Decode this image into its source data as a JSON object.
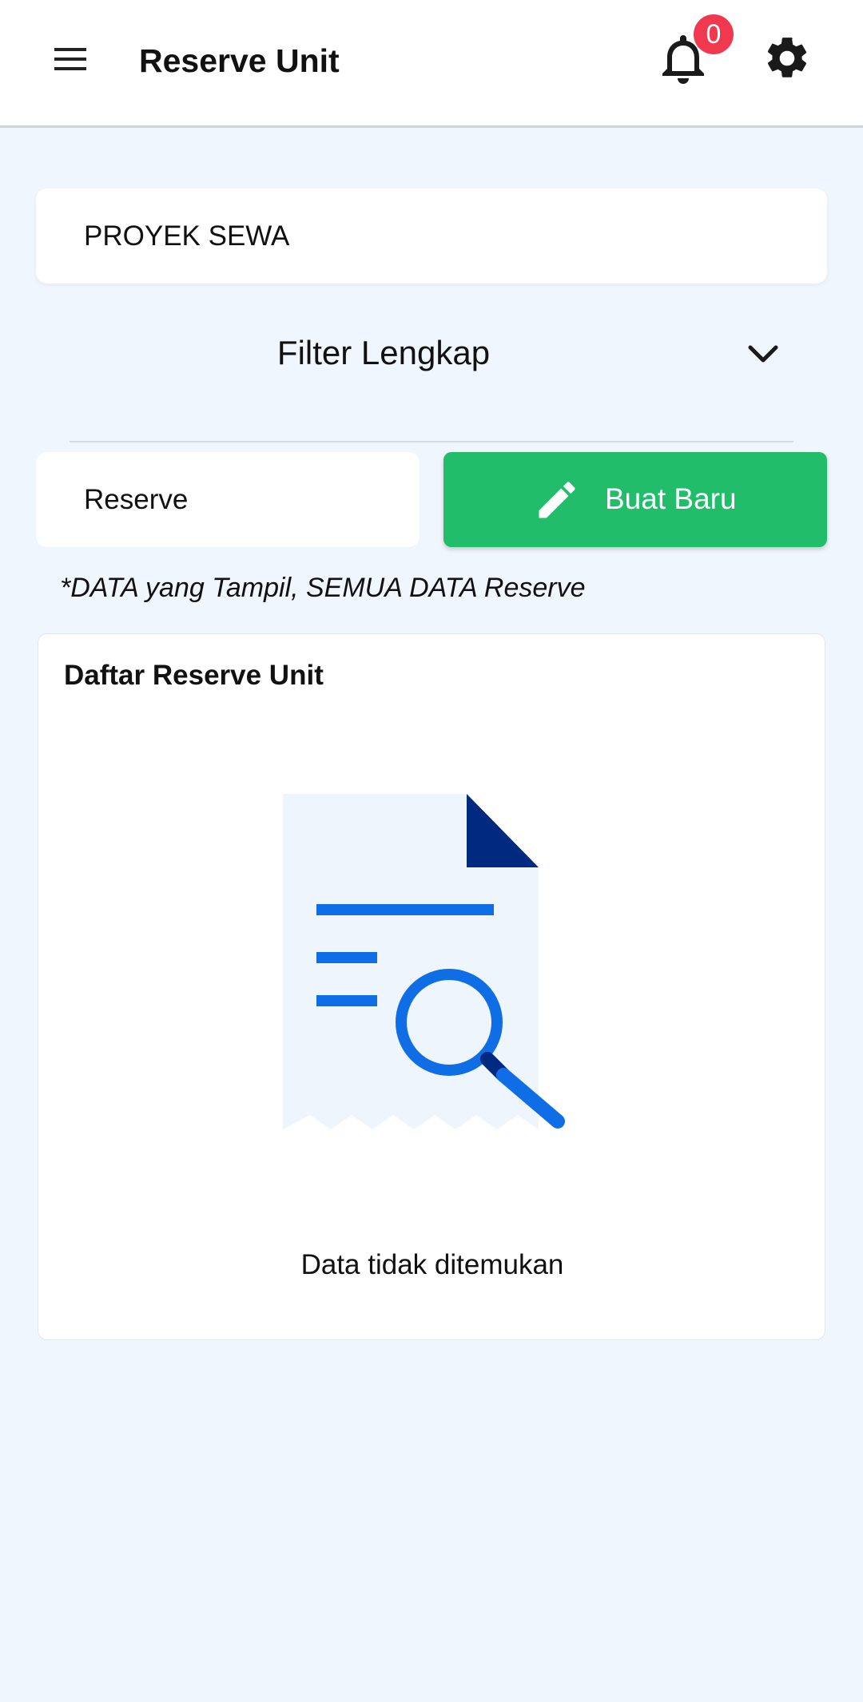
{
  "appbar": {
    "title": "Reserve Unit",
    "notification_count": "0",
    "icons": {
      "menu": "menu-icon",
      "bell": "bell-icon",
      "settings": "gear-icon"
    },
    "badge_color": "#f0384f"
  },
  "project": {
    "value": "PROYEK SEWA"
  },
  "filter": {
    "label": "Filter Lengkap"
  },
  "reserve_type": {
    "value": "Reserve"
  },
  "new_button": {
    "label": "Buat Baru",
    "color": "#21bd6a"
  },
  "note": "*DATA yang Tampil, SEMUA DATA Reserve",
  "list": {
    "title": "Daftar Reserve Unit",
    "empty_message": "Data tidak ditemukan",
    "empty_icon": "document-search-icon"
  },
  "colors": {
    "background": "#f0f6fd",
    "accent_blue": "#0f6ee6",
    "dark_blue": "#002a80"
  }
}
